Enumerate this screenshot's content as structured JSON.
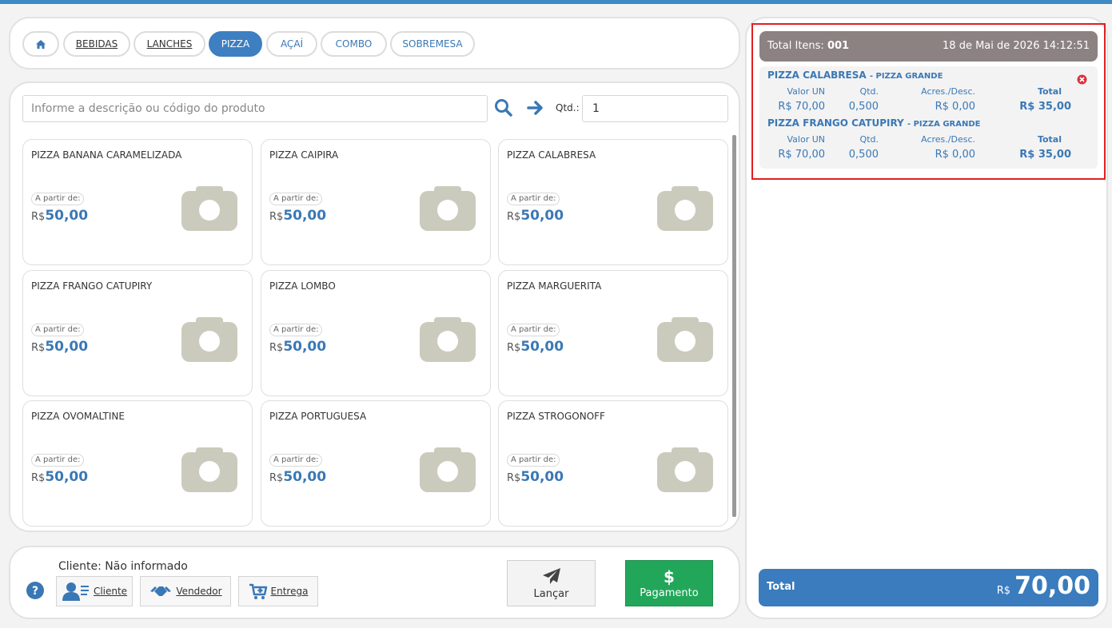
{
  "categories": [
    {
      "label": "",
      "icon": "home-icon"
    },
    {
      "label": "BEBIDAS"
    },
    {
      "label": "LANCHES"
    },
    {
      "label": "PIZZA",
      "active": true
    },
    {
      "label": "AÇAÍ"
    },
    {
      "label": "COMBO"
    },
    {
      "label": "SOBREMESA"
    }
  ],
  "search": {
    "placeholder": "Informe a descrição ou código do produto",
    "qty_label": "Qtd.:",
    "qty_value": "1"
  },
  "products": [
    {
      "name": "PIZZA BANANA CARAMELIZADA",
      "from_label": "A partir de:",
      "currency": "R$",
      "price": "50,00"
    },
    {
      "name": "PIZZA CAIPIRA",
      "from_label": "A partir de:",
      "currency": "R$",
      "price": "50,00"
    },
    {
      "name": "PIZZA CALABRESA",
      "from_label": "A partir de:",
      "currency": "R$",
      "price": "50,00"
    },
    {
      "name": "PIZZA FRANGO CATUPIRY",
      "from_label": "A partir de:",
      "currency": "R$",
      "price": "50,00"
    },
    {
      "name": "PIZZA LOMBO",
      "from_label": "A partir de:",
      "currency": "R$",
      "price": "50,00"
    },
    {
      "name": "PIZZA MARGUERITA",
      "from_label": "A partir de:",
      "currency": "R$",
      "price": "50,00"
    },
    {
      "name": "PIZZA OVOMALTINE",
      "from_label": "A partir de:",
      "currency": "R$",
      "price": "50,00"
    },
    {
      "name": "PIZZA PORTUGUESA",
      "from_label": "A partir de:",
      "currency": "R$",
      "price": "50,00"
    },
    {
      "name": "PIZZA STROGONOFF",
      "from_label": "A partir de:",
      "currency": "R$",
      "price": "50,00"
    }
  ],
  "footer": {
    "client_label": "Cliente: Não informado",
    "cliente_button": "Cliente",
    "vendedor_button": "Vendedor",
    "entrega_button": "Entrega",
    "lancar_button": "Lançar",
    "pagamento_button": "Pagamento",
    "pagamento_symbol": "$"
  },
  "cart": {
    "total_items_label": "Total Itens:",
    "total_items_value": "001",
    "datetime": "18 de Mai de 2026 14:12:51",
    "columns": {
      "unit": "Valor UN",
      "qty": "Qtd.",
      "adj": "Acres./Desc.",
      "total": "Total"
    },
    "items": [
      {
        "name": "PIZZA CALABRESA",
        "size": "- PIZZA GRANDE",
        "unit": "R$ 70,00",
        "qty": "0,500",
        "adj": "R$ 0,00",
        "total": "R$ 35,00"
      },
      {
        "name": "PIZZA FRANGO CATUPIRY",
        "size": "- PIZZA GRANDE",
        "unit": "R$ 70,00",
        "qty": "0,500",
        "adj": "R$ 0,00",
        "total": "R$ 35,00"
      }
    ],
    "total_label": "Total",
    "total_currency": "R$",
    "total_value": "70,00"
  },
  "colors": {
    "accent": "#3d7fc0",
    "pay": "#22a75a",
    "cart_header": "#8c8282",
    "highlight_border": "#e02020"
  }
}
